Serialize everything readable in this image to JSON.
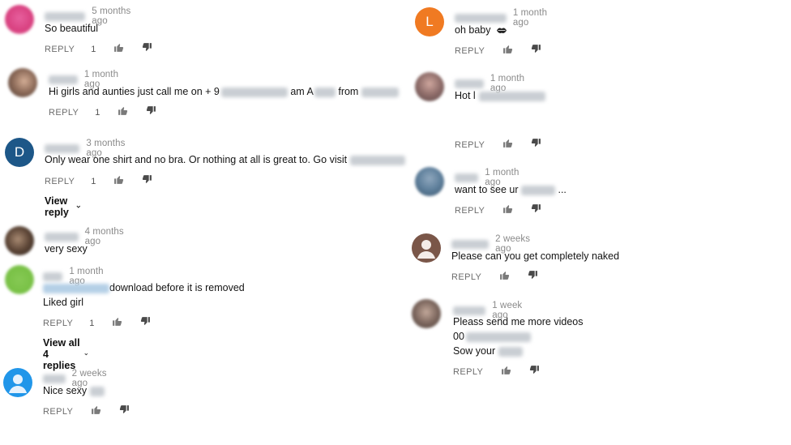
{
  "labels": {
    "reply": "REPLY"
  },
  "icons": {
    "like": "thumbs-up-icon",
    "dislike": "thumbs-down-icon",
    "chevron": "chevron-down-icon",
    "emoji": "kiss-lips-icon"
  },
  "left": {
    "c1": {
      "time": "5 months ago",
      "text": "So beautiful",
      "likes": "1"
    },
    "c2": {
      "time": "1 month ago",
      "text_a": "Hi girls and aunties just call me on + 9",
      "text_b": "am A",
      "text_c": "from",
      "likes": "1"
    },
    "c3": {
      "avatar_letter": "D",
      "time": "3 months ago",
      "text": "Only wear one shirt and no bra. Or nothing at all is great to. Go visit",
      "likes": "1",
      "view_reply": "View reply"
    },
    "c4": {
      "time": "4 months ago",
      "text": "very sexy"
    },
    "c5": {
      "time": "1 month ago",
      "text_line1": "download before it is removed",
      "text_line2": "Liked girl",
      "likes": "1",
      "view_replies": "View all 4 replies"
    },
    "c6": {
      "time": "2 weeks ago",
      "text": "Nice sexy"
    }
  },
  "right": {
    "c1": {
      "avatar_letter": "L",
      "time": "1 month ago",
      "text": "oh baby"
    },
    "c2": {
      "time": "1 month ago",
      "text": "Hot l"
    },
    "c3": {
      "time": "1 month ago",
      "text_a": "want to see ur",
      "text_b": "..."
    },
    "c4": {
      "time": "2 weeks ago",
      "text": "Please can you get completely naked"
    },
    "c5": {
      "time": "1 week ago",
      "text_line1": "Pleass send me more videos",
      "text_line2": "00",
      "text_line3": "Sow your"
    }
  }
}
